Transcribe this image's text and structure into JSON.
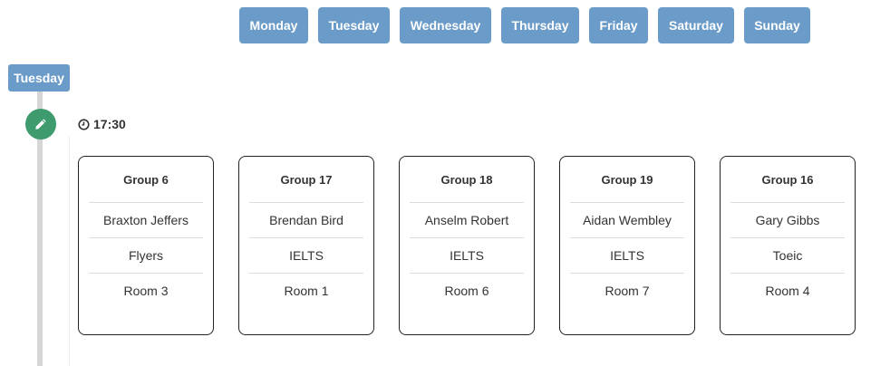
{
  "day_buttons": [
    "Monday",
    "Tuesday",
    "Wednesday",
    "Thursday",
    "Friday",
    "Saturday",
    "Sunday"
  ],
  "selected_day": "Tuesday",
  "timeline": {
    "edit_icon": "pencil-icon",
    "time_icon": "clock-icon",
    "time": "17:30"
  },
  "groups": [
    {
      "title": "Group 6",
      "teacher": "Braxton Jeffers",
      "course": "Flyers",
      "room": "Room 3"
    },
    {
      "title": "Group 17",
      "teacher": "Brendan Bird",
      "course": "IELTS",
      "room": "Room 1"
    },
    {
      "title": "Group 18",
      "teacher": "Anselm Robert",
      "course": "IELTS",
      "room": "Room 6"
    },
    {
      "title": "Group 19",
      "teacher": "Aidan Wembley",
      "course": "IELTS",
      "room": "Room 7"
    },
    {
      "title": "Group 16",
      "teacher": "Gary Gibbs",
      "course": "Toeic",
      "room": "Room 4"
    }
  ],
  "colors": {
    "day_button": "#6b9bc8",
    "edit_button": "#3d9b6e",
    "timeline": "#d6d6d6"
  }
}
